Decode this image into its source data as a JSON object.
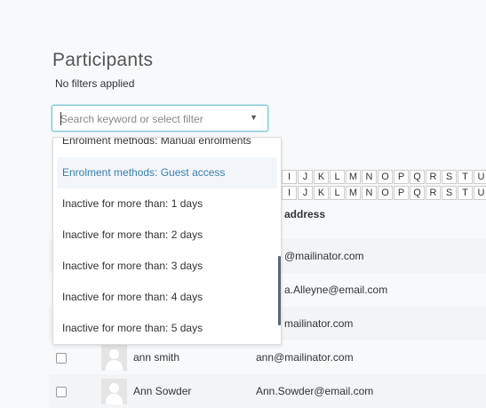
{
  "page": {
    "title": "Participants",
    "filter_status": "No filters applied"
  },
  "search": {
    "placeholder": "Search keyword or select filter",
    "value": ""
  },
  "dropdown": {
    "items": [
      {
        "label": "Enrolment methods: Manual enrolments"
      },
      {
        "label": "Enrolment methods: Guest access"
      },
      {
        "label": "Inactive for more than: 1 days"
      },
      {
        "label": "Inactive for more than: 2 days"
      },
      {
        "label": "Inactive for more than: 3 days"
      },
      {
        "label": "Inactive for more than: 4 days"
      },
      {
        "label": "Inactive for more than: 5 days"
      }
    ]
  },
  "initials": {
    "letters": [
      "I",
      "J",
      "K",
      "L",
      "M",
      "N",
      "O",
      "P",
      "Q",
      "R",
      "S",
      "T",
      "U"
    ]
  },
  "table": {
    "email_header": "address",
    "rows": [
      {
        "name": "",
        "email": "@mailinator.com"
      },
      {
        "name": "",
        "email": "a.Alleyne@email.com"
      },
      {
        "name": "",
        "email": "mailinator.com"
      },
      {
        "name": "ann smith",
        "email": "ann@mailinator.com"
      },
      {
        "name": "Ann Sowder",
        "email": "Ann.Sowder@email.com"
      }
    ]
  },
  "colors": {
    "accent": "#3a7ea8",
    "focus_border": "#7fc9d2",
    "row_stripe": "#f2f4f6"
  }
}
